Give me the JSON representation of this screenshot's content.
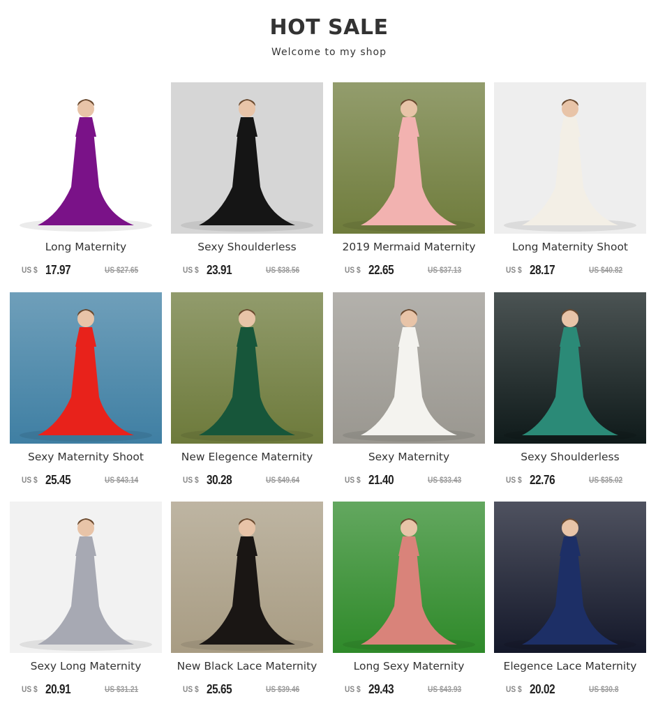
{
  "header": {
    "title": "HOT SALE",
    "subtitle": "Welcome to my shop"
  },
  "products": [
    {
      "name": "Long Maternity",
      "currency": "US $",
      "price": "17.97",
      "original_price": "US $27.65",
      "dress_color": "#7a1288",
      "background": "#ffffff"
    },
    {
      "name": "Sexy Shoulderless",
      "currency": "US $",
      "price": "23.91",
      "original_price": "US $38.56",
      "dress_color": "#151515",
      "background": "#d6d6d6"
    },
    {
      "name": "2019 Mermaid Maternity",
      "currency": "US $",
      "price": "22.65",
      "original_price": "US $37.13",
      "dress_color": "#f2b2b0",
      "background": "#6f7c3c"
    },
    {
      "name": "Long Maternity Shoot",
      "currency": "US $",
      "price": "28.17",
      "original_price": "US $40.82",
      "dress_color": "#f3efe6",
      "background": "#eeeeee"
    },
    {
      "name": "Sexy Maternity Shoot",
      "currency": "US $",
      "price": "25.45",
      "original_price": "US $43.14",
      "dress_color": "#e8221b",
      "background": "#3f7fa3"
    },
    {
      "name": "New Elegence Maternity",
      "currency": "US $",
      "price": "30.28",
      "original_price": "US $49.64",
      "dress_color": "#17563a",
      "background": "#6d7a3b"
    },
    {
      "name": "Sexy Maternity",
      "currency": "US $",
      "price": "21.40",
      "original_price": "US $33.43",
      "dress_color": "#f4f3ef",
      "background": "#9a9790"
    },
    {
      "name": "Sexy Shoulderless",
      "currency": "US $",
      "price": "22.76",
      "original_price": "US $35.02",
      "dress_color": "#2b8a77",
      "background": "#0f1a1a"
    },
    {
      "name": "Sexy Long Maternity",
      "currency": "US $",
      "price": "20.91",
      "original_price": "US $31.21",
      "dress_color": "#a7a9b3",
      "background": "#f2f2f2"
    },
    {
      "name": "New Black Lace Maternity",
      "currency": "US $",
      "price": "25.65",
      "original_price": "US $39.46",
      "dress_color": "#1a1614",
      "background": "#a89c83"
    },
    {
      "name": "Long Sexy Maternity",
      "currency": "US $",
      "price": "29.43",
      "original_price": "US $43.93",
      "dress_color": "#d9837a",
      "background": "#2f8a2a"
    },
    {
      "name": "Elegence Lace Maternity",
      "currency": "US $",
      "price": "20.02",
      "original_price": "US $30.8",
      "dress_color": "#1d2f66",
      "background": "#14182a"
    }
  ]
}
